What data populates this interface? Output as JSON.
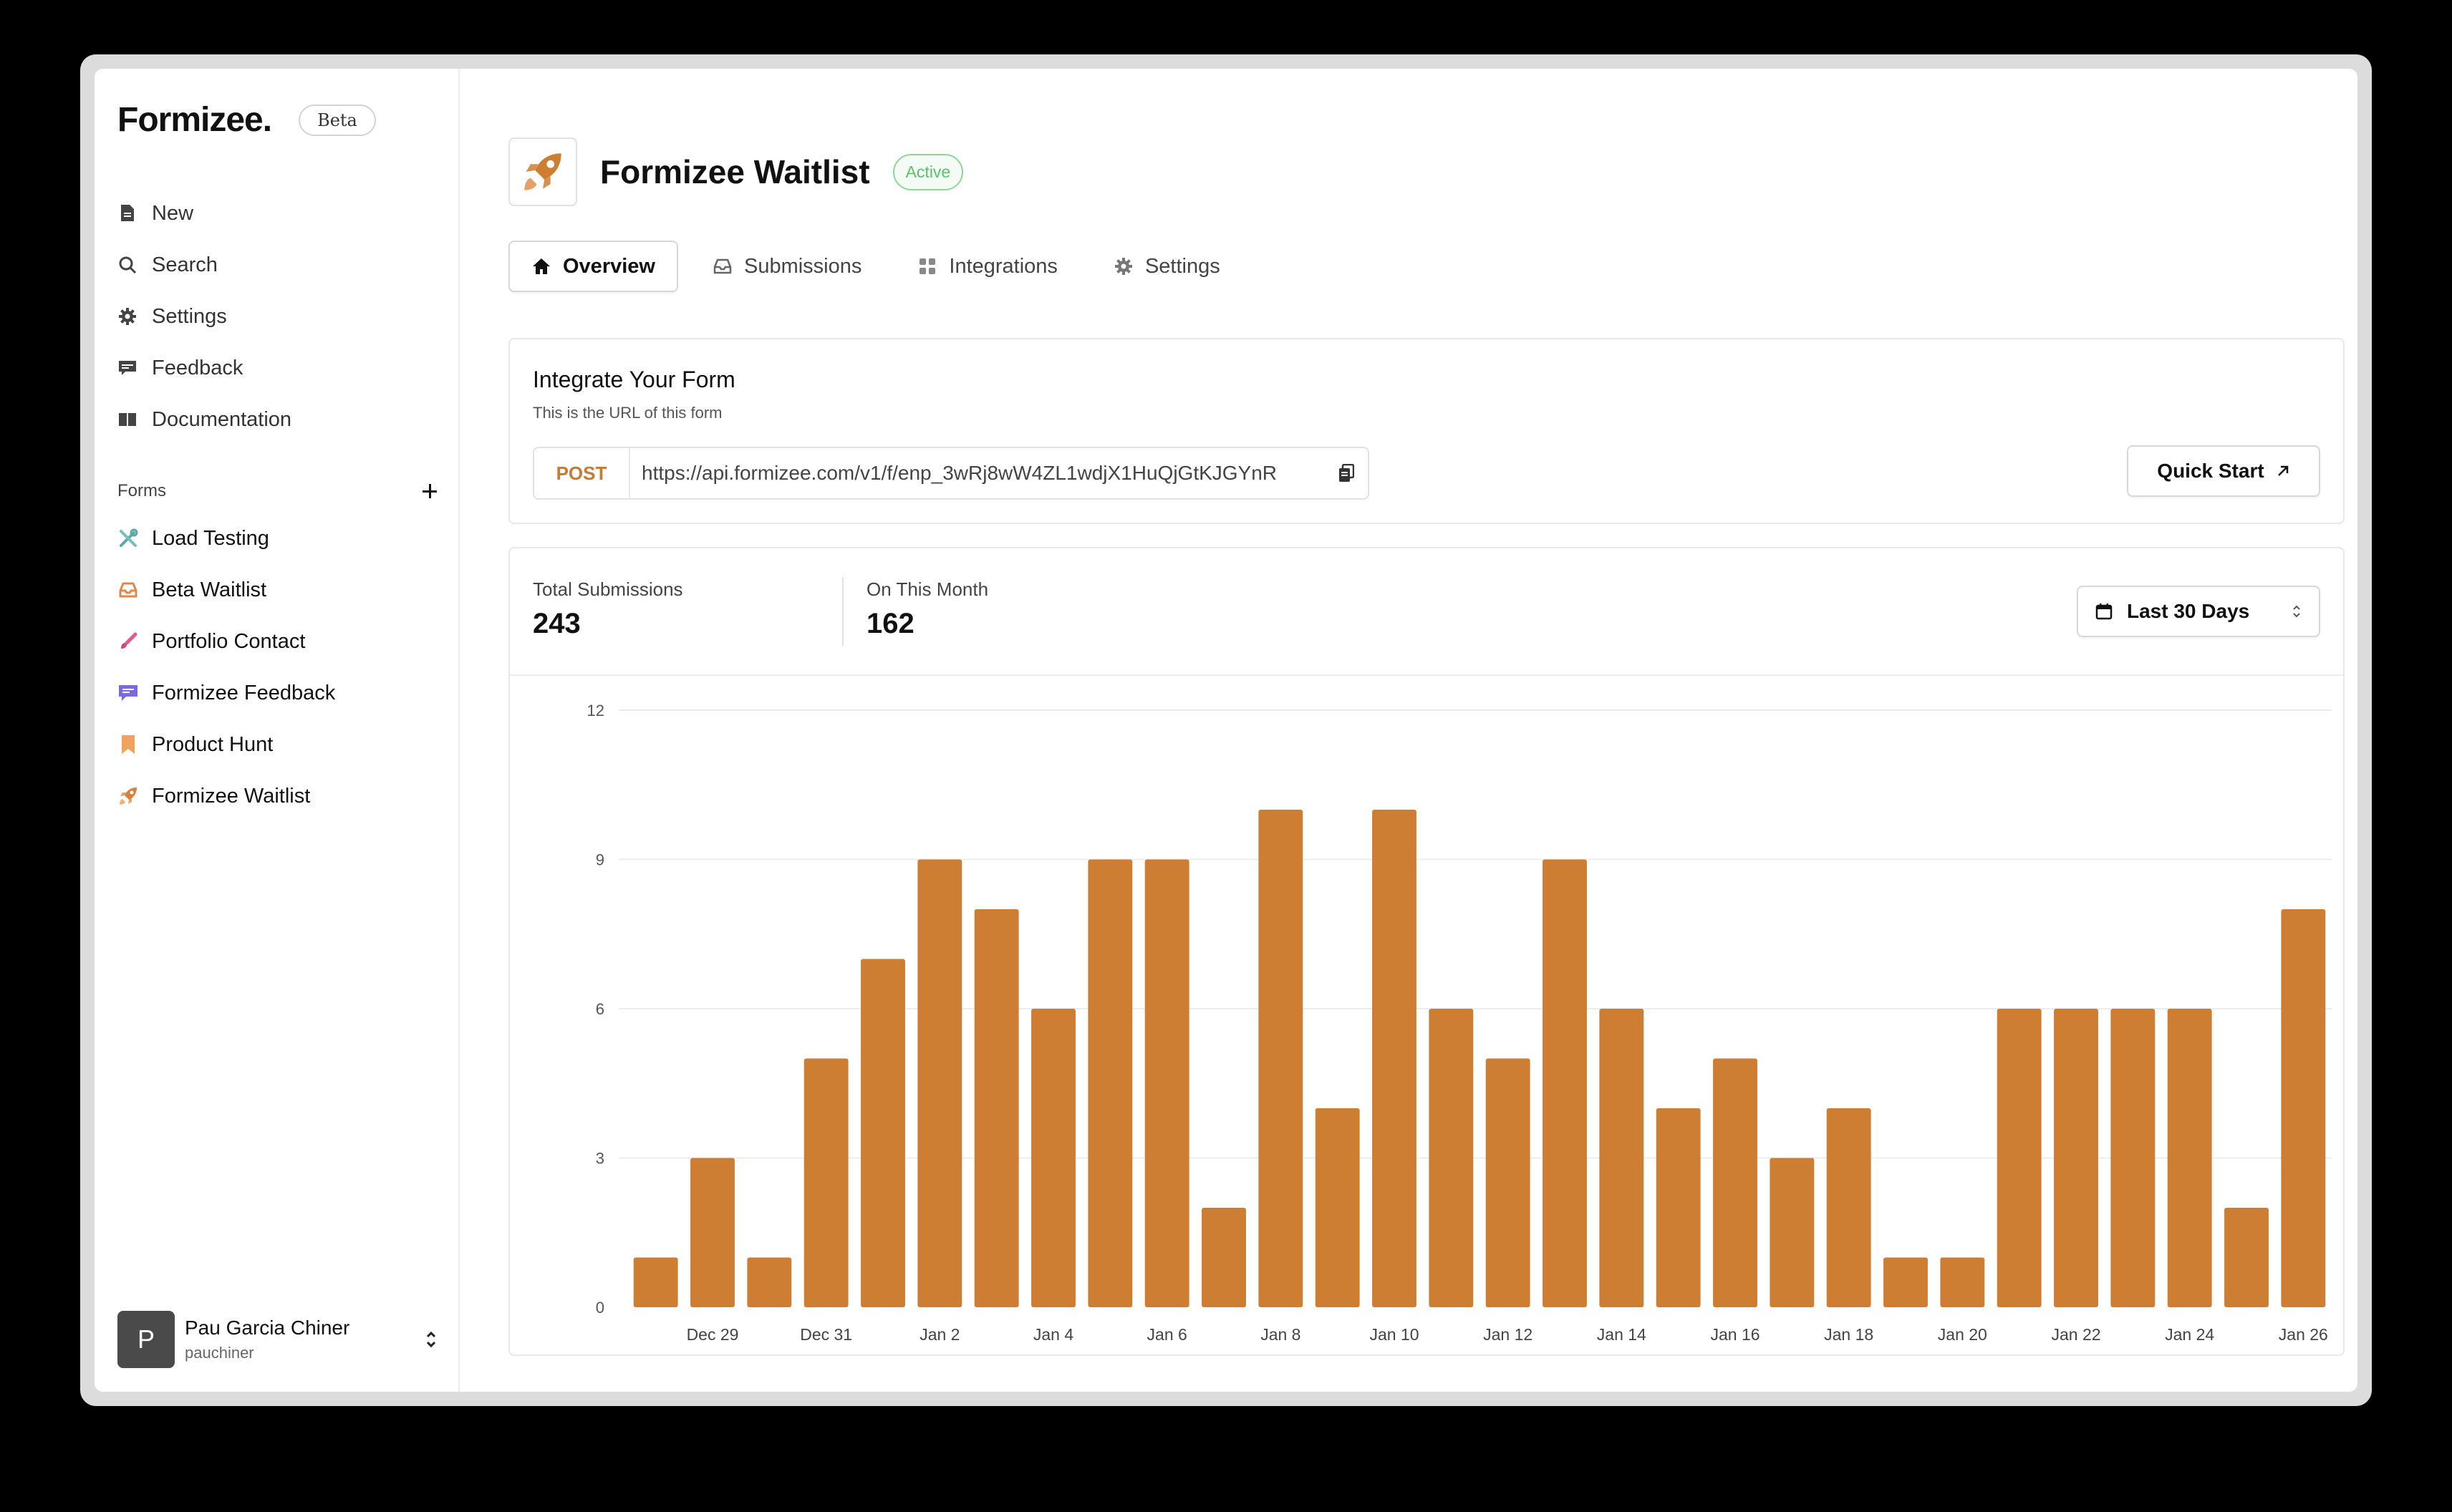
{
  "app": {
    "brand": "Formizee.",
    "beta_label": "Beta"
  },
  "sidebar": {
    "nav": [
      {
        "label": "New",
        "icon": "document-icon"
      },
      {
        "label": "Search",
        "icon": "search-icon"
      },
      {
        "label": "Settings",
        "icon": "gear-icon"
      },
      {
        "label": "Feedback",
        "icon": "chat-icon"
      },
      {
        "label": "Documentation",
        "icon": "book-icon"
      }
    ],
    "forms_title": "Forms",
    "forms": [
      {
        "label": "Load Testing",
        "icon": "tools-icon",
        "color": "#5aa8a8"
      },
      {
        "label": "Beta Waitlist",
        "icon": "inbox-icon",
        "color": "#e0874a"
      },
      {
        "label": "Portfolio Contact",
        "icon": "brush-icon",
        "color": "#e05b8a"
      },
      {
        "label": "Formizee Feedback",
        "icon": "chat-icon",
        "color": "#7a6ae0"
      },
      {
        "label": "Product Hunt",
        "icon": "bookmark-icon",
        "color": "#f0a35a"
      },
      {
        "label": "Formizee Waitlist",
        "icon": "rocket-icon",
        "color": "#d9813a"
      }
    ],
    "user": {
      "initial": "P",
      "name": "Pau Garcia Chiner",
      "handle": "pauchiner"
    }
  },
  "header": {
    "title": "Formizee Waitlist",
    "status": "Active"
  },
  "tabs": [
    {
      "label": "Overview",
      "icon": "home-icon",
      "active": true
    },
    {
      "label": "Submissions",
      "icon": "inbox-icon",
      "active": false
    },
    {
      "label": "Integrations",
      "icon": "grid-icon",
      "active": false
    },
    {
      "label": "Settings",
      "icon": "gear-icon",
      "active": false
    }
  ],
  "integrate": {
    "title": "Integrate Your Form",
    "subtitle": "This is the URL of this form",
    "method": "POST",
    "url": "https://api.formizee.com/v1/f/enp_3wRj8wW4ZL1wdjX1HuQjGtKJGYnR",
    "quick_start": "Quick Start"
  },
  "stats": {
    "total_label": "Total Submissions",
    "total_value": "243",
    "month_label": "On This Month",
    "month_value": "162",
    "range_label": "Last 30 Days"
  },
  "colors": {
    "accent": "#cd7e33",
    "active_green": "#5ac26b"
  },
  "chart_data": {
    "type": "bar",
    "categories": [
      "Dec 28",
      "Dec 29",
      "Dec 30",
      "Dec 31",
      "Jan 1",
      "Jan 2",
      "Jan 3",
      "Jan 4",
      "Jan 5",
      "Jan 6",
      "Jan 7",
      "Jan 8",
      "Jan 9",
      "Jan 10",
      "Jan 11",
      "Jan 12",
      "Jan 13",
      "Jan 14",
      "Jan 15",
      "Jan 16",
      "Jan 17",
      "Jan 18",
      "Jan 19",
      "Jan 20",
      "Jan 21",
      "Jan 22",
      "Jan 23",
      "Jan 24",
      "Jan 25",
      "Jan 26"
    ],
    "values": [
      1,
      3,
      1,
      5,
      7,
      9,
      8,
      6,
      9,
      9,
      2,
      10,
      4,
      10,
      6,
      5,
      9,
      6,
      4,
      5,
      3,
      4,
      1,
      1,
      6,
      6,
      6,
      6,
      2,
      8
    ],
    "x_tick_labels": [
      "Dec 29",
      "Dec 31",
      "Jan 2",
      "Jan 4",
      "Jan 6",
      "Jan 8",
      "Jan 10",
      "Jan 12",
      "Jan 14",
      "Jan 16",
      "Jan 18",
      "Jan 20",
      "Jan 22",
      "Jan 24",
      "Jan 26"
    ],
    "y_ticks": [
      0,
      3,
      6,
      9,
      12
    ],
    "ylim": [
      0,
      12
    ],
    "grid": true,
    "bar_color": "#cd7e33"
  }
}
